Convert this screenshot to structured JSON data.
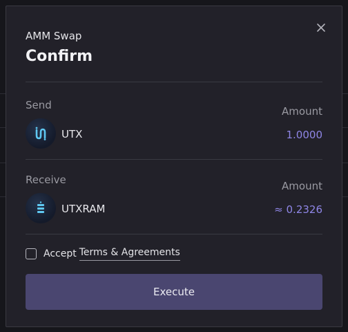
{
  "modal": {
    "subtitle": "AMM Swap",
    "title": "Confirm"
  },
  "send": {
    "label": "Send",
    "amount_label": "Amount",
    "token": "UTX",
    "amount": "1.0000",
    "icon": "utx-token-icon"
  },
  "receive": {
    "label": "Receive",
    "amount_label": "Amount",
    "token": "UTXRAM",
    "amount": "≈ 0.2326",
    "icon": "utxram-token-icon"
  },
  "agreement": {
    "prefix": "Accept",
    "link": "Terms & Agreements",
    "checked": false
  },
  "actions": {
    "execute_label": "Execute"
  },
  "colors": {
    "accent": "#8f86e6",
    "button": "#4a4670",
    "modal_bg": "#222129"
  }
}
